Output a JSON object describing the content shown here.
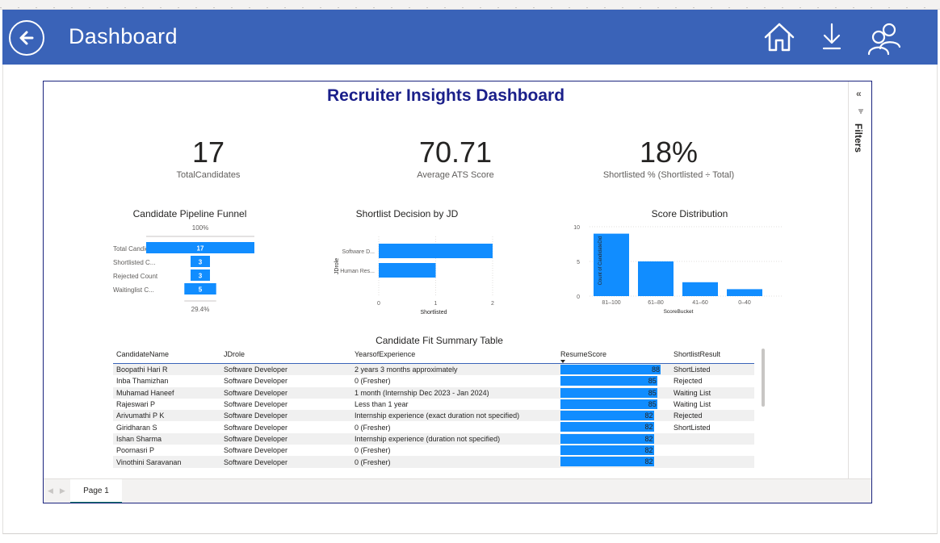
{
  "app": {
    "title": "Dashboard"
  },
  "toolbar": {
    "back": "back-arrow-icon",
    "home": "home-icon",
    "download": "download-icon",
    "users": "people-icon"
  },
  "report": {
    "title": "Recruiter Insights Dashboard",
    "filters_label": "Filters",
    "collapse_glyph": "«"
  },
  "kpis": [
    {
      "value": "17",
      "label": "TotalCandidates"
    },
    {
      "value": "70.71",
      "label": "Average ATS Score"
    },
    {
      "value": "18%",
      "label": "Shortlisted % (Shortlisted ÷ Total)"
    }
  ],
  "funnel": {
    "title": "Candidate Pipeline Funnel",
    "top_label": "100%",
    "bottom_label": "29.4%",
    "categories": [
      "Total Candid...",
      "Shortlisted C...",
      "Rejected Count",
      "Waitinglist C..."
    ],
    "values": [
      17,
      3,
      3,
      5
    ]
  },
  "chart_data": [
    {
      "type": "bar",
      "orientation": "horizontal",
      "title": "Shortlist Decision by JD",
      "categories": [
        "Software D...",
        "Human Res..."
      ],
      "values": [
        2,
        1
      ],
      "xlabel": "Shortlisted",
      "ylabel": "JDrole",
      "xticks": [
        "0",
        "1",
        "2"
      ],
      "xlim": [
        0,
        2
      ],
      "color": "#118dff"
    },
    {
      "type": "bar",
      "title": "Score Distribution",
      "categories": [
        "81–100",
        "61–80",
        "41–60",
        "0–40"
      ],
      "values": [
        9,
        5,
        2,
        1
      ],
      "xlabel": "ScoreBucket",
      "ylabel": "Count of CandidateDid",
      "yticks": [
        "0",
        "5",
        "10"
      ],
      "ylim": [
        0,
        10
      ],
      "color": "#118dff"
    }
  ],
  "table": {
    "title": "Candidate Fit Summary Table",
    "columns": [
      "CandidateName",
      "JDrole",
      "YearsofExperience",
      "ResumeScore",
      "ShortlistResult"
    ],
    "score_max": 88,
    "rows": [
      {
        "name": "Boopathi Hari R",
        "role": "Software Developer",
        "exp": "2 years 3 months approximately",
        "score": 88,
        "result": "ShortListed"
      },
      {
        "name": "Inba Thamizhan",
        "role": "Software Developer",
        "exp": "0 (Fresher)",
        "score": 85,
        "result": "Rejected"
      },
      {
        "name": "Muhamad Haneef",
        "role": "Software Developer",
        "exp": "1 month (Internship Dec 2023 - Jan 2024)",
        "score": 85,
        "result": "Waiting List"
      },
      {
        "name": "Rajeswari P",
        "role": "Software Developer",
        "exp": "Less than 1 year",
        "score": 85,
        "result": "Waiting List"
      },
      {
        "name": "Arivumathi P K",
        "role": "Software Developer",
        "exp": "Internship experience (exact duration not specified)",
        "score": 82,
        "result": "Rejected"
      },
      {
        "name": "Giridharan S",
        "role": "Software Developer",
        "exp": "0 (Fresher)",
        "score": 82,
        "result": "ShortListed"
      },
      {
        "name": "Ishan Sharma",
        "role": "Software Developer",
        "exp": "Internship experience (duration not specified)",
        "score": 82,
        "result": ""
      },
      {
        "name": "Poornasri P",
        "role": "Software Developer",
        "exp": "0 (Fresher)",
        "score": 82,
        "result": ""
      },
      {
        "name": "Vinothini Saravanan",
        "role": "Software Developer",
        "exp": "0 (Fresher)",
        "score": 82,
        "result": ""
      }
    ]
  },
  "tabs": {
    "pages": [
      "Page 1"
    ],
    "active": "Page 1"
  }
}
